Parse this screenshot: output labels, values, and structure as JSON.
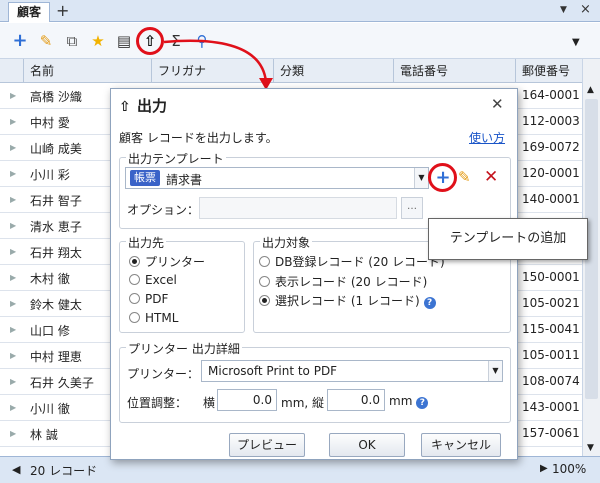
{
  "tab": {
    "label": "顧客",
    "add": "+",
    "close": "×"
  },
  "toolbar": {
    "icons": [
      "add-icon",
      "edit-icon",
      "duplicate-icon",
      "favorite-icon",
      "report-icon",
      "export-icon",
      "sum-icon",
      "search-icon"
    ]
  },
  "grid": {
    "columns": [
      "名前",
      "フリガナ",
      "分類",
      "電話番号",
      "郵便番号"
    ],
    "rows": [
      {
        "name": "高橋 沙織",
        "zip": "164-0001"
      },
      {
        "name": "中村 愛",
        "zip": "112-0003"
      },
      {
        "name": "山崎 成美",
        "zip": "169-0072"
      },
      {
        "name": "小川 彩",
        "zip": "120-0001"
      },
      {
        "name": "石井 智子",
        "zip": "140-0001"
      },
      {
        "name": "清水 恵子",
        "zip": ""
      },
      {
        "name": "石井 翔太",
        "zip": ""
      },
      {
        "name": "木村 徹",
        "zip": "150-0001"
      },
      {
        "name": "鈴木 健太",
        "zip": "105-0021"
      },
      {
        "name": "山口 修",
        "zip": "115-0041"
      },
      {
        "name": "中村 理恵",
        "zip": "105-0011"
      },
      {
        "name": "石井 久美子",
        "zip": "108-0074"
      },
      {
        "name": "小川 徹",
        "zip": "143-0001"
      },
      {
        "name": "林 誠",
        "zip": "157-0061"
      }
    ]
  },
  "status": {
    "record_count": "20 レコード",
    "zoom": "100%"
  },
  "dialog": {
    "title": "出力",
    "message": "顧客 レコードを出力します。",
    "help_link": "使い方",
    "template_group": "出力テンプレート",
    "template_badge": "帳票",
    "template_value": "請求書",
    "option_label": "オプション：",
    "destination_group": "出力先",
    "destinations": [
      "プリンター",
      "Excel",
      "PDF",
      "HTML"
    ],
    "destination_selected": "プリンター",
    "target_group": "出力対象",
    "targets": [
      "DB登録レコード (20 レコード)",
      "表示レコード (20 レコード)",
      "選択レコード (1 レコード)"
    ],
    "target_selected": "選択レコード (1 レコード)",
    "printer_group": "プリンター 出力詳細",
    "printer_label": "プリンター：",
    "printer_value": "Microsoft Print to PDF",
    "position_label": "位置調整：",
    "horizontal_label": "横",
    "horizontal_value": "0.0",
    "horizontal_unit": "mm, 縦",
    "vertical_value": "0.0",
    "vertical_unit": "mm",
    "buttons": {
      "preview": "プレビュー",
      "ok": "OK",
      "cancel": "キャンセル"
    }
  },
  "callout": {
    "text": "テンプレートの追加"
  },
  "colors": {
    "highlight": "#e0101a",
    "link": "#1a55c8",
    "badge": "#3a63c8",
    "add": "#2f6fd6"
  }
}
